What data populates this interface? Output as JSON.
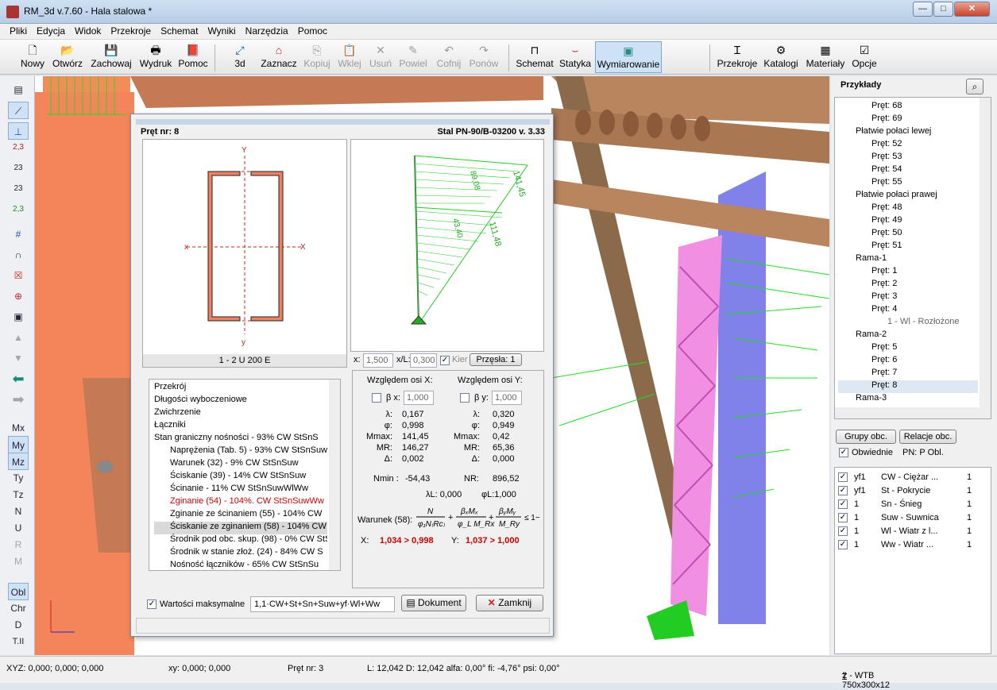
{
  "window": {
    "title": "RM_3d v.7.60 - Hala stalowa *",
    "min": "—",
    "max": "□",
    "close": "✕"
  },
  "menu": [
    "Pliki",
    "Edycja",
    "Widok",
    "Przekroje",
    "Schemat",
    "Wyniki",
    "Narzędzia",
    "Pomoc"
  ],
  "toolbar": {
    "nowy": "Nowy",
    "otworz": "Otwórz",
    "zachowaj": "Zachowaj",
    "wydruk": "Wydruk",
    "pomoc": "Pomoc",
    "v3d": "3d",
    "zaznacz": "Zaznacz",
    "kopiuj": "Kopiuj",
    "wklej": "Wklej",
    "usun": "Usuń",
    "powiel": "Powiel",
    "cofnij": "Cofnij",
    "ponow": "Ponów",
    "schemat": "Schemat",
    "statyka": "Statyka",
    "wymiarowanie": "Wymiarowanie",
    "przekroje": "Przekroje",
    "katalogi": "Katalogi",
    "materialy": "Materiały",
    "opcje": "Opcje"
  },
  "left": {
    "labels": [
      "2,3",
      "23",
      "23",
      "2,3"
    ],
    "mx": "Mx",
    "my": "My",
    "mz": "Mz",
    "ty": "Ty",
    "tz": "Tz",
    "n": "N",
    "u": "U",
    "r": "R",
    "m": "M",
    "obl": "Obl",
    "chr": "Chr",
    "d": "D",
    "tii": "T.II"
  },
  "dialog": {
    "pret": "Pręt nr:  8",
    "norm": "Stal PN-90/B-03200 v. 3.33",
    "section_label": "1 - 2 U 200 E",
    "axes": {
      "y": "Y",
      "x": "X",
      "xs": "x",
      "ys": "y"
    },
    "diag_values": [
      "141,45",
      "89,08",
      "111,48",
      "43,40"
    ],
    "x_label": "x:",
    "x_value": "1,500",
    "xl_label": "x/L:",
    "xl_value": "0,300",
    "kier": "Kier",
    "przesla": "Przęsła: 1",
    "list": [
      "Przekrój",
      "Długości wyboczeniowe",
      "Zwichrzenie",
      "Łączniki",
      "Stan graniczny nośności - 93%   CW StSnS",
      "Naprężenia (Tab. 5) - 93%    CW StSnSuw",
      "Warunek (32) - 9%   CW StSnSuw",
      "Ściskanie (39) - 14%   CW StSnSuw",
      "Ścinanie - 11%   CW StSnSuwWlWw",
      "Zginanie (54) - 104%.   CW StSnSuwWw",
      "Zginanie ze ścinaniem (55) - 104%   CW",
      "Ściskanie ze zginaniem (58) - 104%   CW",
      "Środnik pod obc. skup. (98) - 0%   CW StSn",
      "Środnik w stanie złoż. (24) - 84%   CW S",
      "Nośność łączników - 65%   CW StSnSu"
    ],
    "osx": {
      "title": "Względem osi X:",
      "beta": "β x:",
      "beta_val": "1,000",
      "lam": "λ:",
      "lam_v": "0,167",
      "phi": "φ:",
      "phi_v": "0,998",
      "mmax": "Mmax:",
      "mmax_v": "141,45",
      "mr": "MR:",
      "mr_v": "146,27",
      "delta": "Δ:",
      "delta_v": "0,002"
    },
    "osy": {
      "title": "Względem osi Y:",
      "beta": "β y:",
      "beta_val": "1,000",
      "lam": "λ:",
      "lam_v": "0,320",
      "phi": "φ:",
      "phi_v": "0,949",
      "mmax": "Mmax:",
      "mmax_v": "0,42",
      "mr": "MR:",
      "mr_v": "65,36",
      "delta": "Δ:",
      "delta_v": "0,000"
    },
    "nmin": "Nmin :",
    "nmin_v": "-54,43",
    "nr": "NR:",
    "nr_v": "896,52",
    "laml": "λL: 0,000",
    "phil": "φL:1,000",
    "warunek": "Warunek (58):",
    "cond_x": "X:",
    "cond_x_v": "1,034 > 0,998",
    "cond_y": "Y:",
    "cond_y_v": "1,037 > 1,000",
    "wartosci": "Wartości maksymalne",
    "combo": "1,1·CW+St+Sn+Suw+yf·Wl+Ww",
    "dokument": "Dokument",
    "zamknij": "Zamknij"
  },
  "right": {
    "title": "Przykłady",
    "tree": [
      "Pręt: 68",
      "Pręt: 69",
      "Płatwie połaci lewej",
      "Pręt: 52",
      "Pręt: 53",
      "Pręt: 54",
      "Pręt: 55",
      "Płatwie połaci prawej",
      "Pręt: 48",
      "Pręt: 49",
      "Pręt: 50",
      "Pręt: 51",
      "Rama-1",
      "Pręt: 1",
      "Pręt: 2",
      "Pręt: 3",
      "Pręt: 4",
      "1 - Wl - Rozłożone",
      "Rama-2",
      "Pręt: 5",
      "Pręt: 6",
      "Pręt: 7",
      "Pręt: 8",
      "Rama-3"
    ],
    "grupy": "Grupy obc.",
    "relacje": "Relacje obc.",
    "obwiednie": "Obwiednie",
    "pn": "PN:  P Obl.",
    "loads": [
      [
        "yf1",
        "CW - Ciężar ...",
        "1"
      ],
      [
        "yf1",
        "St - Pokrycie",
        "1"
      ],
      [
        "1",
        "Sn - Śnieg",
        "1"
      ],
      [
        "1",
        "Suw - Suwnica",
        "1"
      ],
      [
        "1",
        "Wl - Wiatr z l...",
        "1"
      ],
      [
        "1",
        "Ww - Wiatr ...",
        "1"
      ]
    ]
  },
  "status": {
    "xyz": "XYZ: 0,000; 0,000; 0,000",
    "xy": "xy: 0,000; 0,000",
    "pret": "Pręt nr: 3",
    "len": "L: 12,042 D: 12,042 alfa: 0,00° fi: -4,76° psi: 0,00°",
    "sect": "2 - WTB 750x300x12"
  },
  "colors": {
    "accent": "#cde2f7",
    "danger": "#cc0000",
    "beam": "#c47a52",
    "truss": "#f18fe2",
    "wall": "#6b6be6",
    "load": "#22dd22"
  }
}
